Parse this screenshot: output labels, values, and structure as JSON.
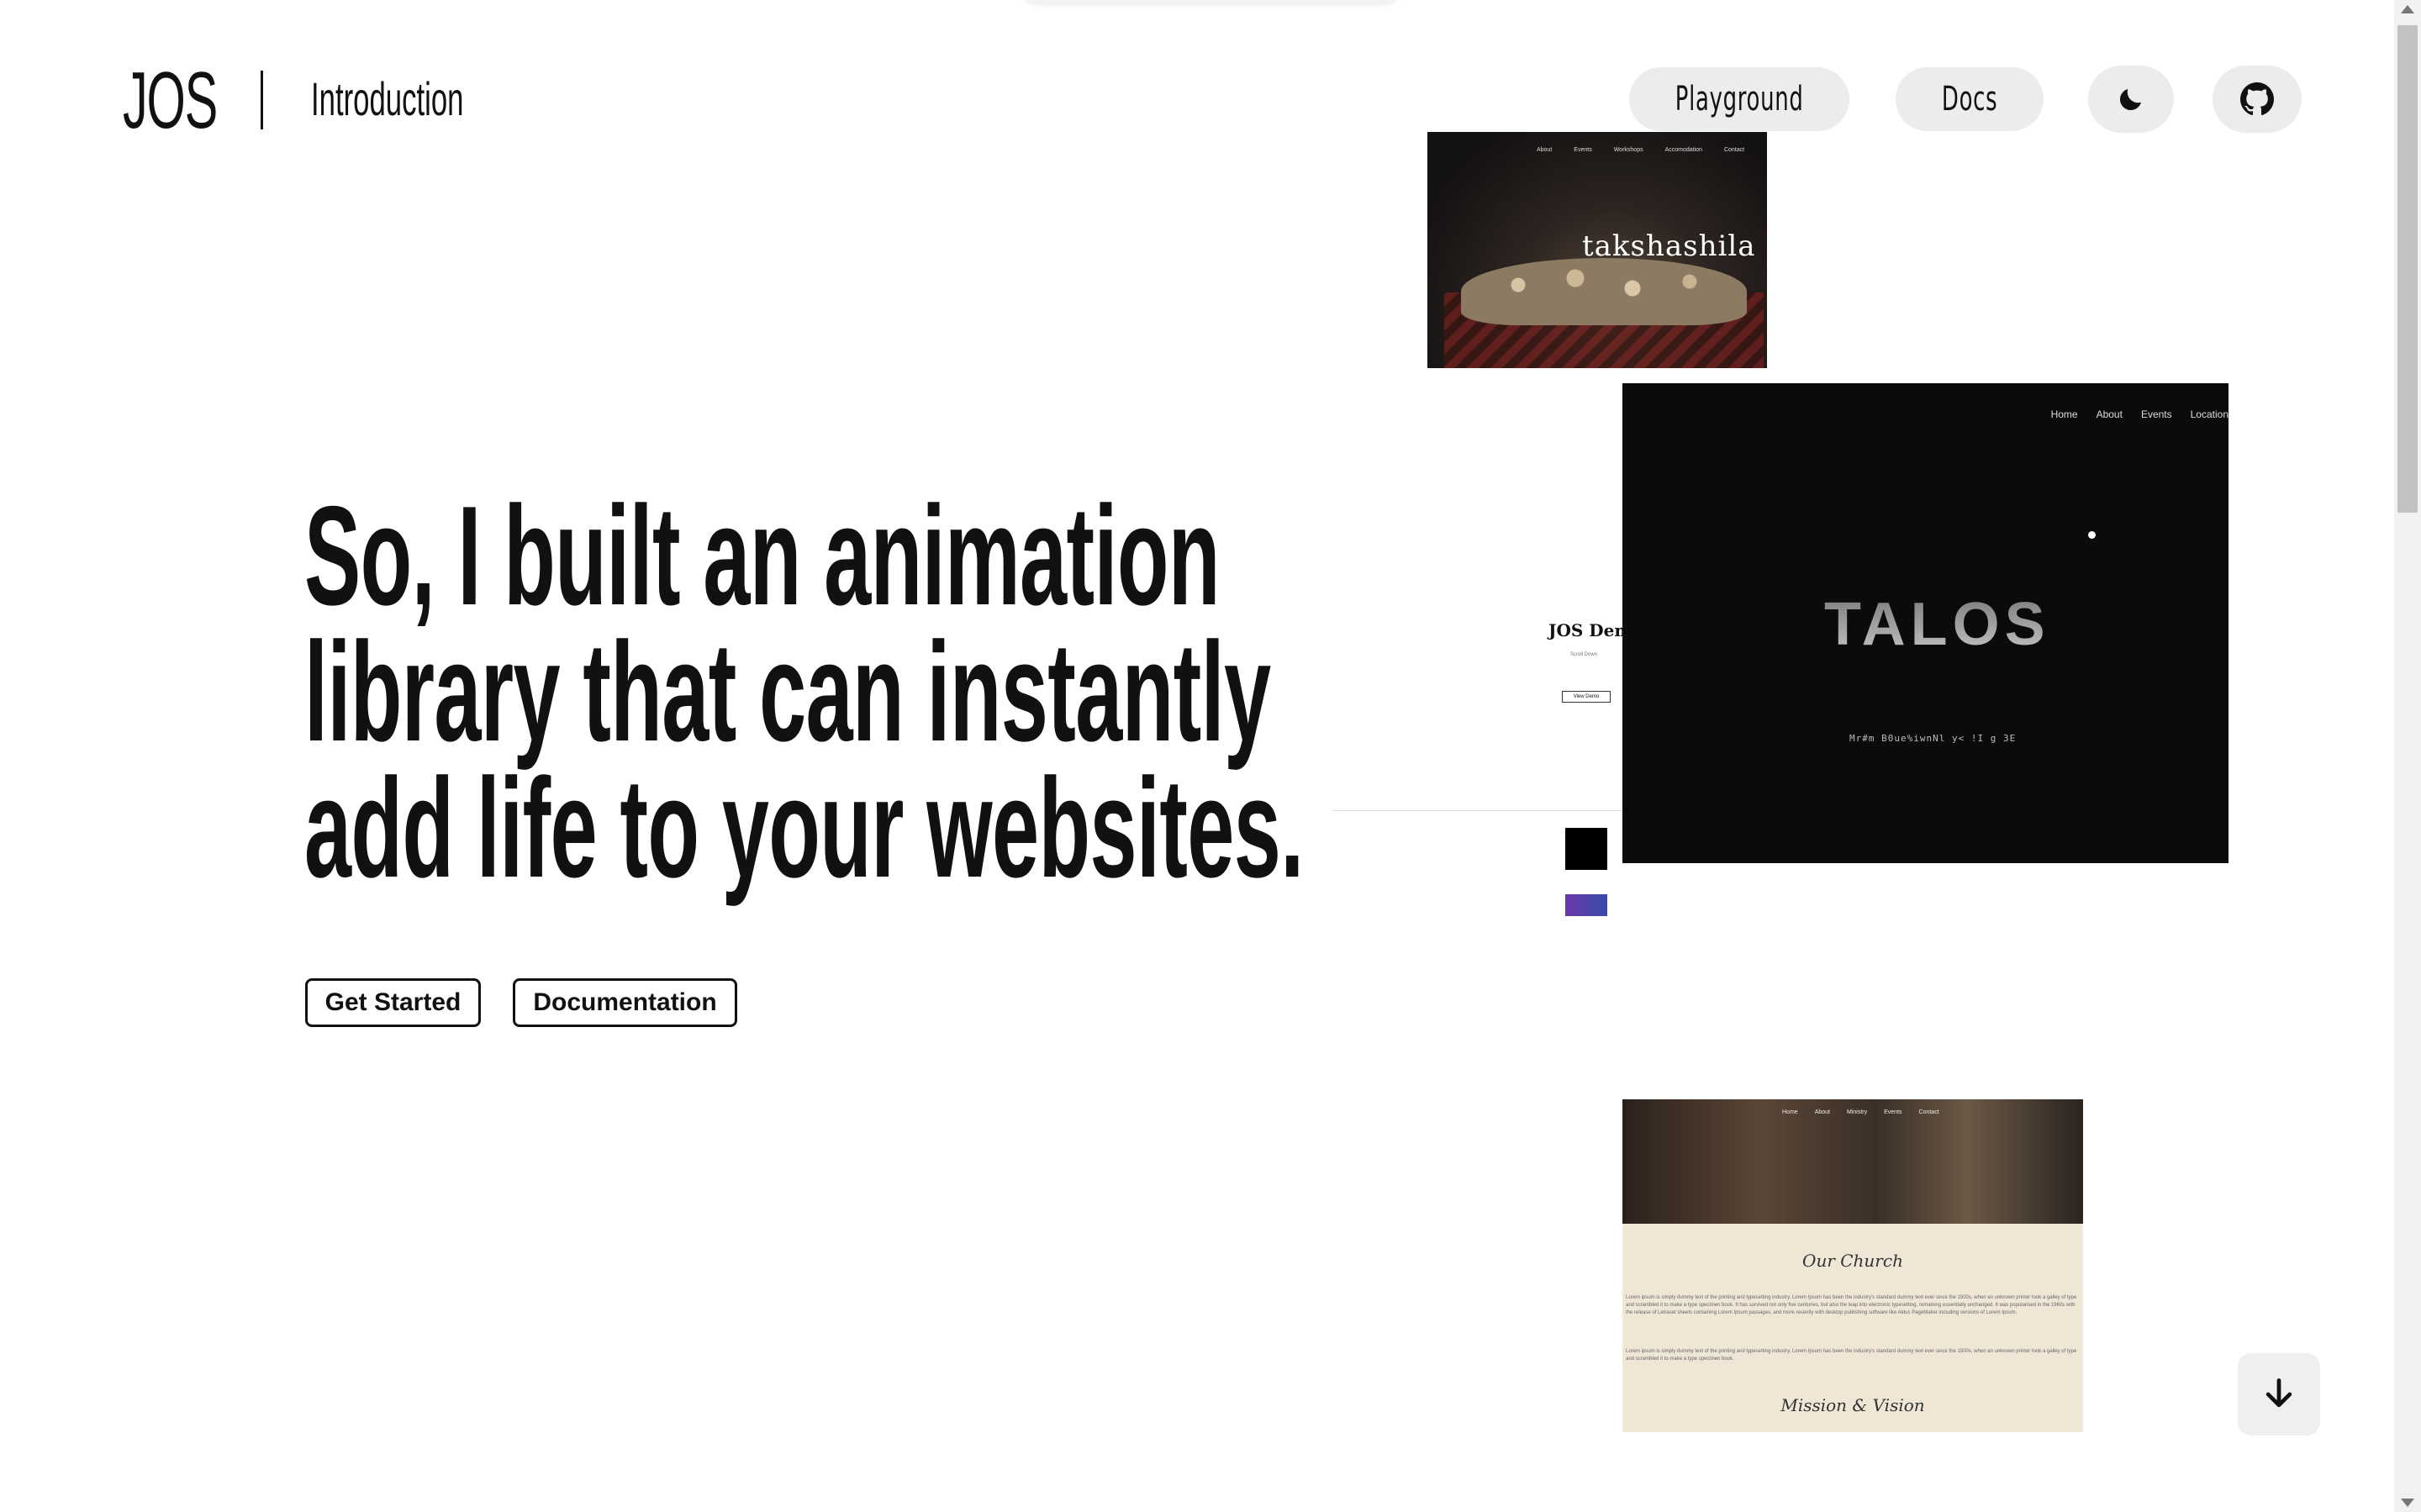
{
  "header": {
    "logo": "JOS",
    "breadcrumb": "Introduction",
    "nav": {
      "playground": "Playground",
      "docs": "Docs"
    },
    "icons": {
      "theme": "moon-icon",
      "github": "github-icon"
    }
  },
  "hero": {
    "lines": [
      "So, I built an animation",
      "library that can instantly",
      "add life to your websites."
    ],
    "buttons": {
      "get_started": "Get Started",
      "documentation": "Documentation"
    }
  },
  "showcase": {
    "takshashila": {
      "title": "takshashila",
      "nav": [
        "About",
        "Events",
        "Workshops",
        "Accomodation",
        "Contact"
      ]
    },
    "jos_demo": {
      "title": "JOS Demo",
      "subtitle": "Scroll Down",
      "button": "View Demo"
    },
    "talos": {
      "title": "TALOS",
      "subtitle": "Mr#m B0ue%iwnNl y< !I g 3E",
      "nav": [
        "Home",
        "About",
        "Events",
        "Location"
      ]
    },
    "church": {
      "nav": [
        "Home",
        "About",
        "Ministry",
        "Events",
        "Contact"
      ],
      "heading1": "Our Church",
      "heading2": "Mission & Vision",
      "paragraph1": "Lorem ipsum is simply dummy text of the printing and typesetting industry. Lorem Ipsum has been the industry's standard dummy text ever since the 1500s, when an unknown printer took a galley of type and scrambled it to make a type specimen book. It has survived not only five centuries, but also the leap into electronic typesetting, remaining essentially unchanged. It was popularised in the 1960s with the release of Letraset sheets containing Lorem Ipsum passages, and more recently with desktop publishing software like Aldus PageMaker including versions of Lorem Ipsum.",
      "paragraph2": "Lorem ipsum is simply dummy text of the printing and typesetting industry. Lorem Ipsum has been the industry's standard dummy text ever since the 1500s, when an unknown printer took a galley of type and scrambled it to make a type specimen book."
    }
  },
  "scroll_down_icon": "arrow-down-icon",
  "colors": {
    "text": "#111111",
    "pill_bg": "#ececec",
    "talos_bg": "#0b0b0b",
    "church_bg": "#efe6d6"
  }
}
